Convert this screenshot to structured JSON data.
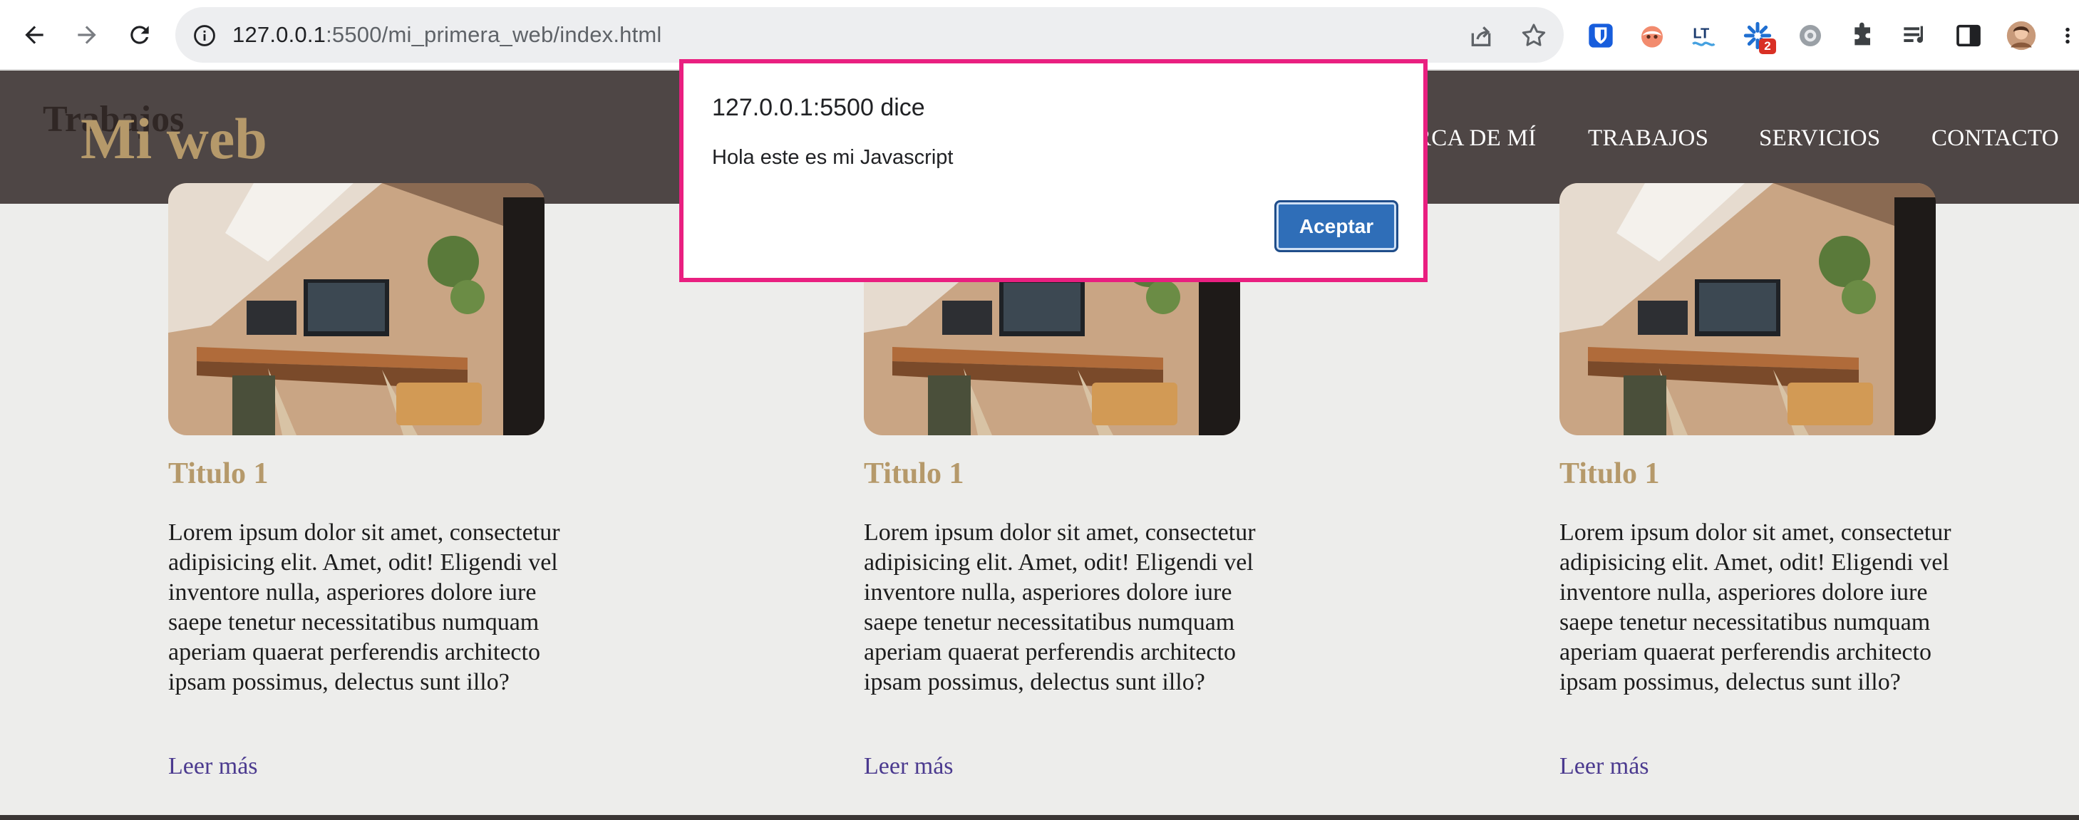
{
  "browser": {
    "url_host": "127.0.0.1",
    "url_rest": ":5500/mi_primera_web/index.html",
    "extensions": [
      "bitwarden-icon",
      "privacy-badger-icon",
      "languagetool-icon",
      "colorful-extension-icon",
      "gear-extension-icon",
      "puzzle-extensions-icon",
      "reading-list-icon",
      "side-panel-icon",
      "profile-avatar"
    ],
    "extension_badge": "2"
  },
  "header": {
    "ghost_title": "Trabajos",
    "logo": "Mi web",
    "nav": [
      "RCA DE MÍ",
      "TRABAJOS",
      "SERVICIOS",
      "CONTACTO"
    ]
  },
  "cards": [
    {
      "title": "Titulo 1",
      "text": "Lorem ipsum dolor sit amet, consectetur adipisicing elit. Amet, odit! Eligendi vel inventore nulla, asperiores dolore iure saepe tenetur necessitatibus numquam aperiam quaerat perferendis architecto ipsam possimus, delectus sunt illo?",
      "link": "Leer más"
    },
    {
      "title": "Titulo 1",
      "text": "Lorem ipsum dolor sit amet, consectetur adipisicing elit. Amet, odit! Eligendi vel inventore nulla, asperiores dolore iure saepe tenetur necessitatibus numquam aperiam quaerat perferendis architecto ipsam possimus, delectus sunt illo?",
      "link": "Leer más"
    },
    {
      "title": "Titulo 1",
      "text": "Lorem ipsum dolor sit amet, consectetur adipisicing elit. Amet, odit! Eligendi vel inventore nulla, asperiores dolore iure saepe tenetur necessitatibus numquam aperiam quaerat perferendis architecto ipsam possimus, delectus sunt illo?",
      "link": "Leer más"
    }
  ],
  "alert": {
    "title": "127.0.0.1:5500 dice",
    "message": "Hola este es mi Javascript",
    "ok_label": "Aceptar"
  },
  "colors": {
    "header_bg": "#4e4645",
    "accent_gold": "#b5996a",
    "link": "#4b3a8f",
    "page_bg": "#ededeb",
    "alert_highlight": "#e91f80",
    "button_blue": "#2f6eb8"
  }
}
